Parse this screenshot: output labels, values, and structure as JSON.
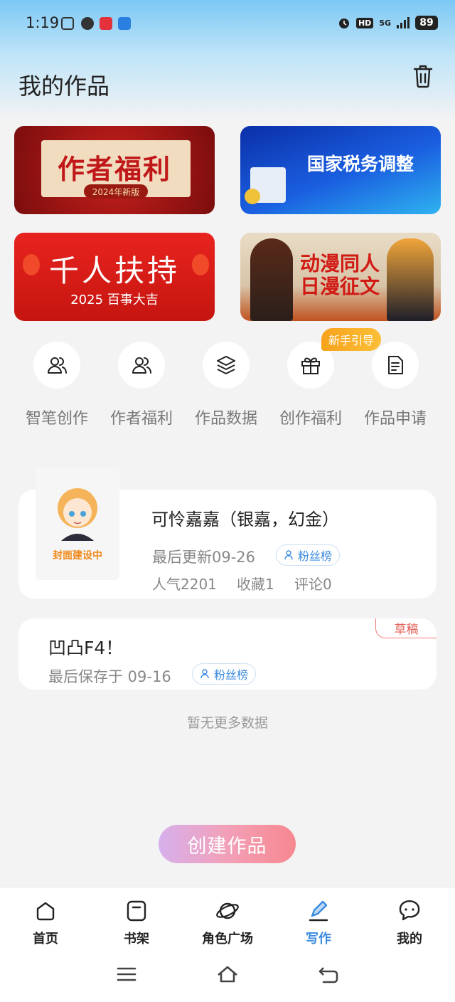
{
  "status": {
    "time": "1:19",
    "network": "5G",
    "battery": "89"
  },
  "header": {
    "title": "我的作品"
  },
  "banners": [
    {
      "title": "作者福利",
      "subtitle": "2024年新版"
    },
    {
      "title": "国家税务调整"
    },
    {
      "title": "千人扶持",
      "subtitle": "2025 百事大吉"
    },
    {
      "title": "动漫同人\n日漫征文"
    }
  ],
  "shortcuts": [
    {
      "label": "智笔创作",
      "icon": "users-icon"
    },
    {
      "label": "作者福利",
      "icon": "users-icon"
    },
    {
      "label": "作品数据",
      "icon": "layers-icon"
    },
    {
      "label": "创作福利",
      "icon": "gift-icon"
    },
    {
      "label": "作品申请",
      "icon": "document-icon"
    }
  ],
  "newbie_badge": "新手引导",
  "works": [
    {
      "title": "可怜嘉嘉（银嘉，幻金）",
      "cover_text": "封面建设中",
      "updated": "最后更新09-26",
      "tag": "粉丝榜",
      "popularity": "人气2201",
      "favorites": "收藏1",
      "comments": "评论0"
    }
  ],
  "drafts": [
    {
      "title": "凹凸F4！",
      "saved": "最后保存于 09-16",
      "tag": "粉丝榜",
      "badge": "草稿"
    }
  ],
  "no_more": "暂无更多数据",
  "create_button": "创建作品",
  "tabs": [
    {
      "label": "首页",
      "icon": "home-icon"
    },
    {
      "label": "书架",
      "icon": "bookshelf-icon"
    },
    {
      "label": "角色广场",
      "icon": "planet-icon"
    },
    {
      "label": "写作",
      "icon": "pen-icon",
      "active": true
    },
    {
      "label": "我的",
      "icon": "chat-icon"
    }
  ],
  "colors": {
    "accent": "#3a8be0",
    "draft": "#e35e55",
    "newbie": "#f7a21b"
  }
}
